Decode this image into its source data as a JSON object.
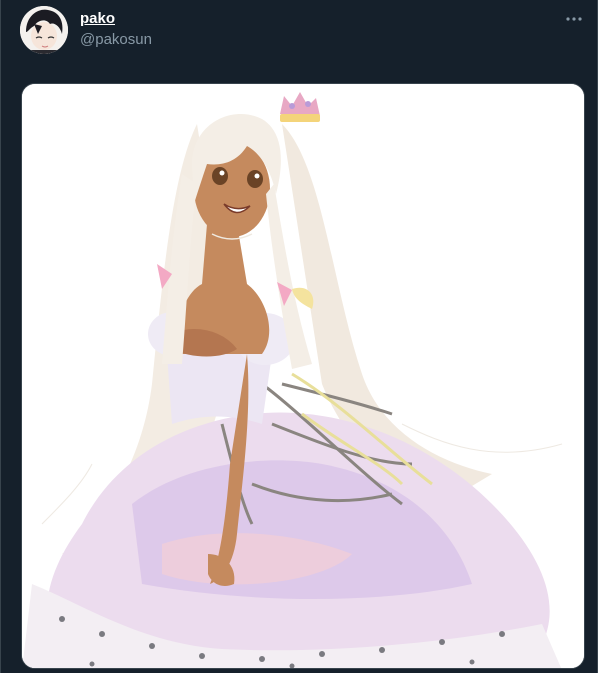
{
  "tweet": {
    "author": {
      "display_name": "pako",
      "handle": "@pakosun"
    },
    "more_icon": "more-horizontal-icon",
    "media": {
      "icon": "illustration-image"
    }
  },
  "colors": {
    "background": "#15202b",
    "primary_text": "#ffffff",
    "secondary_text": "#8899a6",
    "border": "#38444d"
  }
}
